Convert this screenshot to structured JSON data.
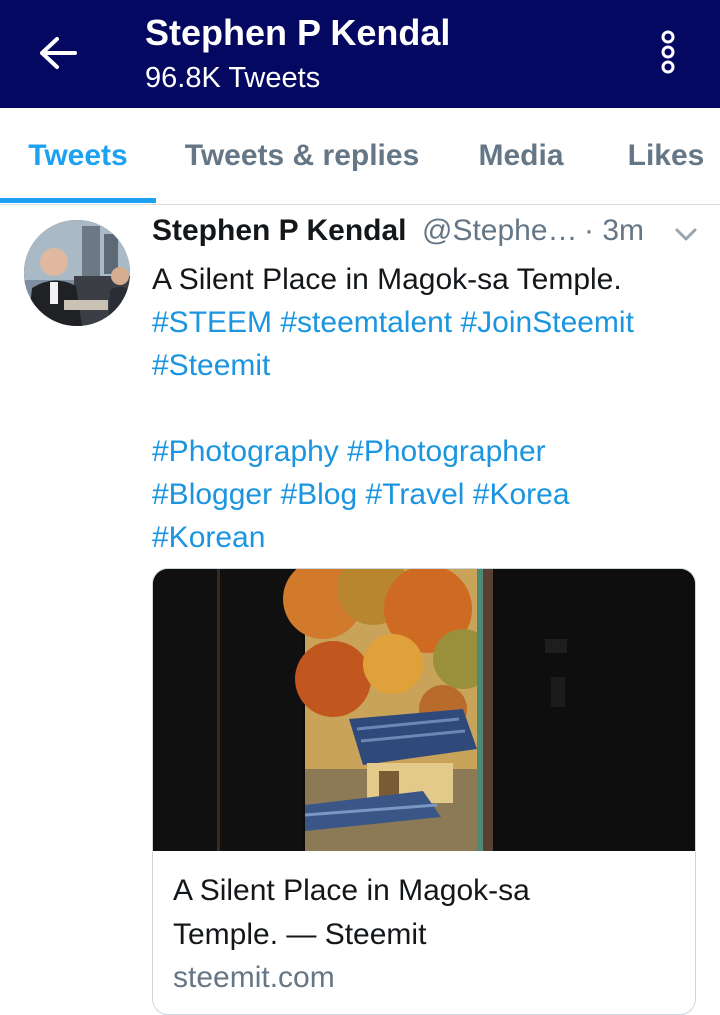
{
  "header": {
    "title": "Stephen P Kendal",
    "tweet_count": "96.8K Tweets",
    "back_icon": "arrow-left-icon",
    "more_icon": "more-vertical-icon",
    "background_color": "#050861"
  },
  "tabs": [
    {
      "label": "Tweets",
      "active": true
    },
    {
      "label": "Tweets & replies",
      "active": false
    },
    {
      "label": "Media",
      "active": false
    },
    {
      "label": "Likes",
      "active": false
    }
  ],
  "tweet": {
    "author_name": "Stephen P Kendal",
    "author_handle": "@Stephe…",
    "separator": "·",
    "time": "3m",
    "text_line1": "A Silent Place in Magok-sa Temple.",
    "hashtags_line1": [
      "#STEEM",
      "#steemtalent",
      "#JoinSteemit"
    ],
    "hashtags_line2": [
      "#Steemit"
    ],
    "hashtags_line3": [
      "#Photography",
      "#Photographer"
    ],
    "hashtags_line4": [
      "#Blogger",
      "#Blog",
      "#Travel",
      "#Korea"
    ],
    "hashtags_line5": [
      "#Korean"
    ],
    "card": {
      "title_line1": "A Silent Place in Magok-sa",
      "title_line2": "Temple. — Steemit",
      "domain": "steemit.com"
    }
  },
  "colors": {
    "accent": "#1da1f2",
    "hashtag": "#1b95e0",
    "secondary_text": "#657786"
  }
}
